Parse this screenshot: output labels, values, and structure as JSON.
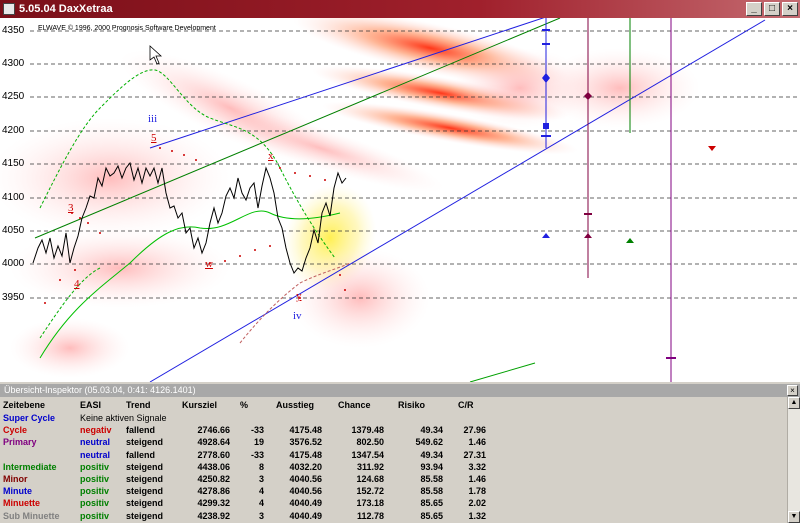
{
  "window": {
    "title": "5.05.04 DaxXetraa"
  },
  "chart": {
    "copyright": "ELWAVE © 1996, 2000 Prognosis Software Development",
    "y_ticks": [
      "4350",
      "4300",
      "4250",
      "4200",
      "4150",
      "4100",
      "4050",
      "4000",
      "3950"
    ],
    "wave_labels": {
      "iii": "iii",
      "five": "5",
      "three": "3",
      "four": "4",
      "w": "w",
      "x": "x",
      "y": "y",
      "iv": "iv"
    }
  },
  "panel": {
    "title": "Übersicht-Inspektor (05.03.04, 0:41: 4126.1401)",
    "headers": [
      "Zeitebene",
      "EASI",
      "Trend",
      "Kursziel",
      "%",
      "Ausstieg",
      "Chance",
      "Risiko",
      "C/R"
    ],
    "rows": [
      {
        "level": "Super Cycle",
        "easi": "Keine aktiven Signale",
        "trend": "",
        "kursziel": "",
        "pct": "",
        "ausstieg": "",
        "chance": "",
        "risiko": "",
        "cr": "",
        "color": "#0000cc",
        "easi_color": "#000000"
      },
      {
        "level": "Cycle",
        "easi": "negativ",
        "trend": "fallend",
        "kursziel": "2746.66",
        "pct": "-33",
        "ausstieg": "4175.48",
        "chance": "1379.48",
        "risiko": "49.34",
        "cr": "27.96",
        "color": "#cc0000",
        "easi_color": "#cc0000"
      },
      {
        "level": "Primary",
        "easi": "neutral",
        "trend": "steigend",
        "kursziel": "4928.64",
        "pct": "19",
        "ausstieg": "3576.52",
        "chance": "802.50",
        "risiko": "549.62",
        "cr": "1.46",
        "color": "#800080",
        "easi_color": "#0000cc"
      },
      {
        "level": "",
        "easi": "neutral",
        "trend": "fallend",
        "kursziel": "2778.60",
        "pct": "-33",
        "ausstieg": "4175.48",
        "chance": "1347.54",
        "risiko": "49.34",
        "cr": "27.31",
        "color": "#800080",
        "easi_color": "#0000cc"
      },
      {
        "level": "Intermediate",
        "easi": "positiv",
        "trend": "steigend",
        "kursziel": "4438.06",
        "pct": "8",
        "ausstieg": "4032.20",
        "chance": "311.92",
        "risiko": "93.94",
        "cr": "3.32",
        "color": "#008000",
        "easi_color": "#008000"
      },
      {
        "level": "Minor",
        "easi": "positiv",
        "trend": "steigend",
        "kursziel": "4250.82",
        "pct": "3",
        "ausstieg": "4040.56",
        "chance": "124.68",
        "risiko": "85.58",
        "cr": "1.46",
        "color": "#800000",
        "easi_color": "#008000"
      },
      {
        "level": "Minute",
        "easi": "positiv",
        "trend": "steigend",
        "kursziel": "4278.86",
        "pct": "4",
        "ausstieg": "4040.56",
        "chance": "152.72",
        "risiko": "85.58",
        "cr": "1.78",
        "color": "#0000cc",
        "easi_color": "#008000"
      },
      {
        "level": "Minuette",
        "easi": "positiv",
        "trend": "steigend",
        "kursziel": "4299.32",
        "pct": "4",
        "ausstieg": "4040.49",
        "chance": "173.18",
        "risiko": "85.65",
        "cr": "2.02",
        "color": "#cc0000",
        "easi_color": "#008000"
      },
      {
        "level": "Sub Minuette",
        "easi": "positiv",
        "trend": "steigend",
        "kursziel": "4238.92",
        "pct": "3",
        "ausstieg": "4040.49",
        "chance": "112.78",
        "risiko": "85.65",
        "cr": "1.32",
        "color": "#808080",
        "easi_color": "#008000"
      }
    ]
  },
  "colors": {
    "accent": "#a0202c"
  }
}
